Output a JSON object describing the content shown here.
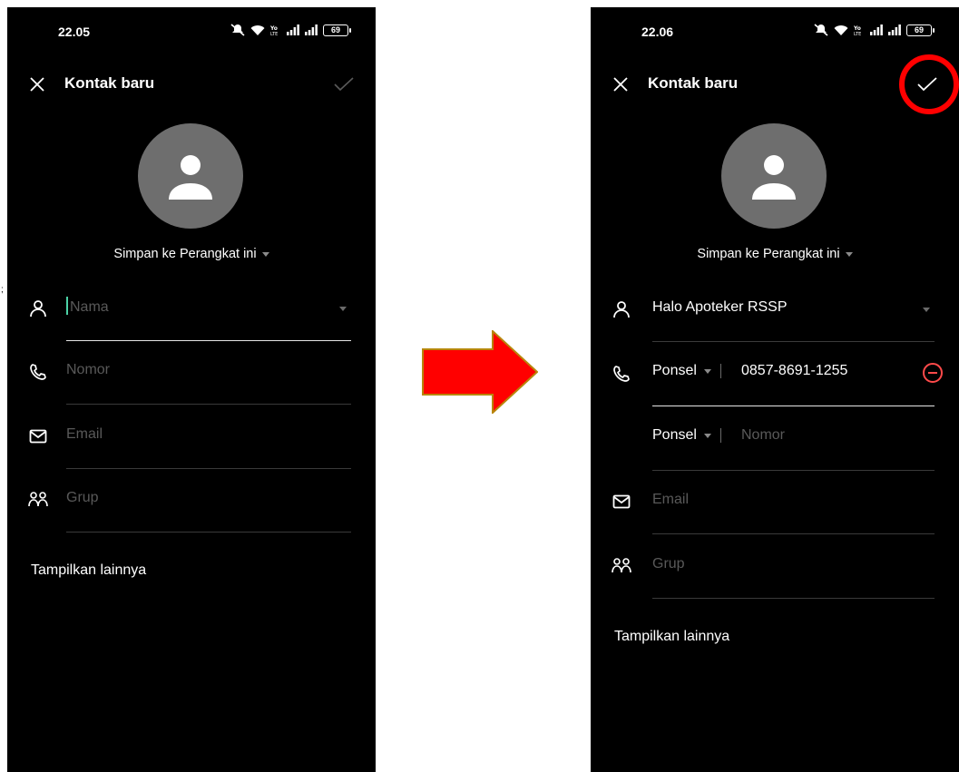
{
  "left_screen": {
    "status_time": "22.05",
    "battery": "69",
    "title": "Kontak baru",
    "save_to_prefix": "Simpan ke ",
    "save_to_target": "Perangkat ini",
    "name_placeholder": "Nama",
    "number_placeholder": "Nomor",
    "email_placeholder": "Email",
    "group_placeholder": "Grup",
    "show_more": "Tampilkan lainnya"
  },
  "right_screen": {
    "status_time": "22.06",
    "battery": "69",
    "title": "Kontak baru",
    "save_to_prefix": "Simpan ke ",
    "save_to_target": "Perangkat ini",
    "name_value": "Halo Apoteker RSSP",
    "phone_type_1": "Ponsel",
    "phone_value_1": "0857-8691-1255",
    "phone_type_2": "Ponsel",
    "number_placeholder": "Nomor",
    "email_placeholder": "Email",
    "group_placeholder": "Grup",
    "show_more": "Tampilkan lainnya"
  },
  "colors": {
    "screen_bg": "#000000",
    "avatar_bg": "#6e6e6e",
    "highlight": "#ff0000",
    "arrow_fill": "#ff0000",
    "arrow_border": "#b8860b",
    "cursor": "#4cd2a6",
    "remove": "#ff4a4a"
  },
  "icons": [
    "close-icon",
    "check-icon",
    "person-icon",
    "phone-icon",
    "email-icon",
    "group-icon",
    "wifi-icon",
    "signal-icon",
    "mute-icon",
    "battery-icon",
    "remove-icon",
    "arrow-right-icon"
  ]
}
